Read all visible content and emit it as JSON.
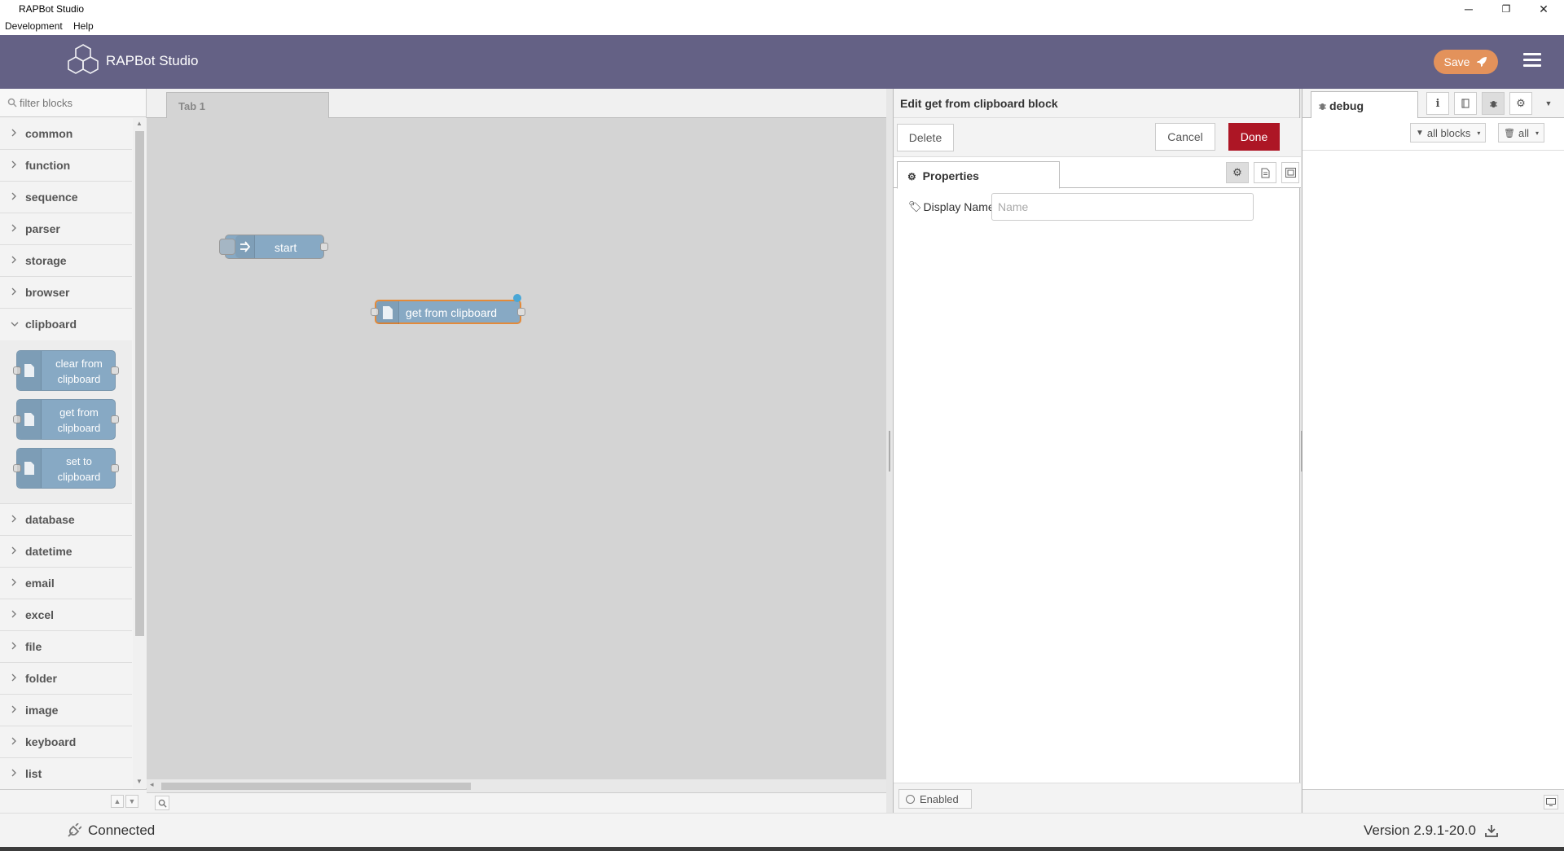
{
  "window": {
    "title": "RAPBot Studio",
    "menus": [
      "Development",
      "Help"
    ],
    "controls": {
      "minimize": "─",
      "restore": "❐",
      "close": "✕"
    }
  },
  "header": {
    "app_name": "RAPBot Studio",
    "save_label": "Save",
    "colors": {
      "bar": "#646185",
      "save": "#e3925b"
    }
  },
  "palette": {
    "filter_placeholder": "filter blocks",
    "categories_top": [
      "common",
      "function",
      "sequence",
      "parser",
      "storage",
      "browser"
    ],
    "open_category": "clipboard",
    "open_blocks": [
      {
        "line1": "clear from",
        "line2": "clipboard"
      },
      {
        "line1": "get from",
        "line2": "clipboard"
      },
      {
        "line1": "set to",
        "line2": "clipboard"
      }
    ],
    "categories_bottom": [
      "database",
      "datetime",
      "email",
      "excel",
      "file",
      "folder",
      "image",
      "keyboard",
      "list"
    ]
  },
  "workspace": {
    "tab_label": "Tab 1",
    "nodes": {
      "start_label": "start",
      "clipboard_label": "get from clipboard"
    }
  },
  "tray": {
    "title": "Edit get from clipboard block",
    "delete_label": "Delete",
    "cancel_label": "Cancel",
    "done_label": "Done",
    "properties_tab": "Properties",
    "display_name_label": "Display Name",
    "display_name_placeholder": "Name",
    "display_name_value": "",
    "enabled_label": "Enabled",
    "colors": {
      "done": "#ad1625"
    }
  },
  "sidebar": {
    "tab_label": "debug",
    "filter_label": "all blocks",
    "clear_label": "all"
  },
  "status": {
    "connection": "Connected",
    "version": "Version 2.9.1-20.0"
  }
}
